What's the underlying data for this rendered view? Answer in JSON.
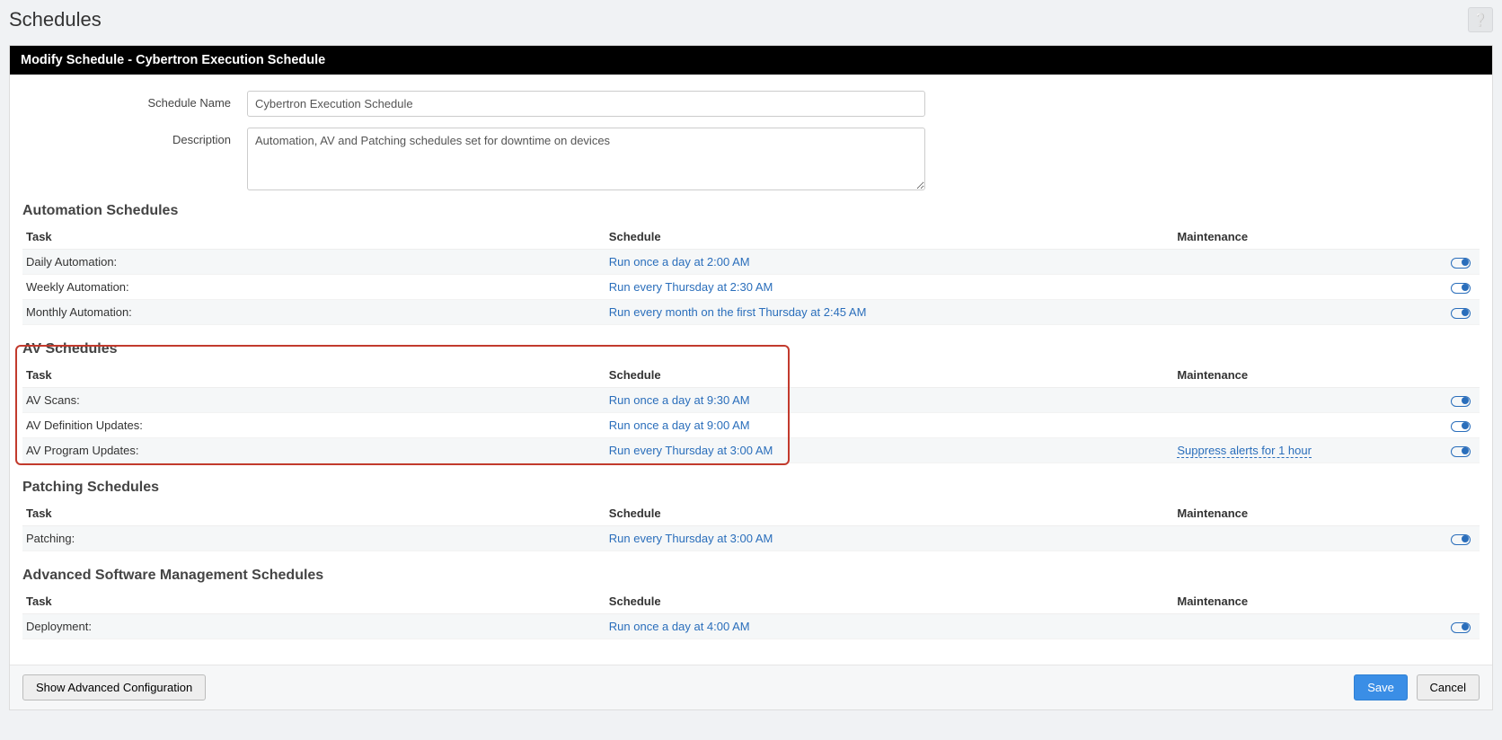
{
  "page": {
    "title": "Schedules"
  },
  "panel": {
    "header": "Modify Schedule - Cybertron Execution Schedule"
  },
  "form": {
    "schedule_name_label": "Schedule Name",
    "schedule_name_value": "Cybertron Execution Schedule",
    "description_label": "Description",
    "description_value": "Automation, AV and Patching schedules set for downtime on devices"
  },
  "columns": {
    "task": "Task",
    "schedule": "Schedule",
    "maintenance": "Maintenance"
  },
  "sections": {
    "automation": {
      "title": "Automation Schedules",
      "rows": [
        {
          "task": "Daily Automation:",
          "schedule": "Run once a day at 2:00 AM",
          "maintenance": "",
          "toggle": true
        },
        {
          "task": "Weekly Automation:",
          "schedule": "Run every Thursday at 2:30 AM",
          "maintenance": "",
          "toggle": true
        },
        {
          "task": "Monthly Automation:",
          "schedule": "Run every month on the first Thursday at 2:45 AM",
          "maintenance": "",
          "toggle": true
        }
      ]
    },
    "av": {
      "title": "AV Schedules",
      "rows": [
        {
          "task": "AV Scans:",
          "schedule": "Run once a day at 9:30 AM",
          "maintenance": "",
          "toggle": true
        },
        {
          "task": "AV Definition Updates:",
          "schedule": "Run once a day at 9:00 AM",
          "maintenance": "",
          "toggle": true
        },
        {
          "task": "AV Program Updates:",
          "schedule": "Run every Thursday at 3:00 AM",
          "maintenance": "Suppress alerts for 1 hour",
          "toggle": true
        }
      ]
    },
    "patching": {
      "title": "Patching Schedules",
      "rows": [
        {
          "task": "Patching:",
          "schedule": "Run every Thursday at 3:00 AM",
          "maintenance": "",
          "toggle": true
        }
      ]
    },
    "asm": {
      "title": "Advanced Software Management Schedules",
      "rows": [
        {
          "task": "Deployment:",
          "schedule": "Run once a day at 4:00 AM",
          "maintenance": "",
          "toggle": true
        }
      ]
    }
  },
  "footer": {
    "advanced": "Show Advanced Configuration",
    "save": "Save",
    "cancel": "Cancel"
  }
}
